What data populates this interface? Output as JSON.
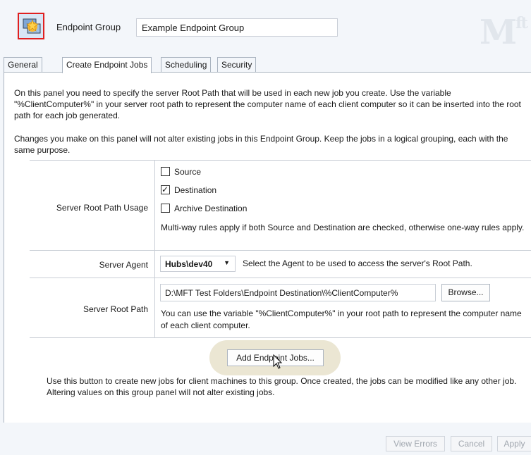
{
  "header": {
    "group_label": "Endpoint Group",
    "group_name": "Example Endpoint Group",
    "logo_text": "M",
    "logo_sup": "ft",
    "icon": "endpoint-group-icon"
  },
  "tabs": [
    {
      "label": "General",
      "active": false
    },
    {
      "label": "Create Endpoint Jobs",
      "active": true
    },
    {
      "label": "Scheduling",
      "active": false
    },
    {
      "label": "Security",
      "active": false
    }
  ],
  "panel": {
    "intro_1": "On this panel you need to specify the server Root Path that will be used in each new job you create. Use the variable \"%ClientComputer%\" in your server root path to represent the computer name of each client computer so it can be inserted into the root path for each job generated.",
    "intro_2": "Changes you make on this panel will not alter existing jobs in this Endpoint Group. Keep the jobs in a logical grouping, each with the same purpose.",
    "usage": {
      "label": "Server Root Path Usage",
      "options": [
        {
          "label": "Source",
          "checked": false
        },
        {
          "label": "Destination",
          "checked": true
        },
        {
          "label": "Archive Destination",
          "checked": false
        }
      ],
      "note": "Multi-way rules apply if both Source and Destination are checked, otherwise one-way rules apply."
    },
    "agent": {
      "label": "Server Agent",
      "selected": "Hubs\\dev40",
      "note": "Select the Agent to be used to access the server's Root Path."
    },
    "root_path": {
      "label": "Server Root Path",
      "value": "D:\\MFT Test Folders\\Endpoint Destination\\%ClientComputer%",
      "browse_label": "Browse...",
      "note": "You can use the variable \"%ClientComputer%\" in your root path to represent the computer name of each client computer."
    },
    "add_button_label": "Add Endpoint Jobs...",
    "add_note": "Use this button to create new jobs for client machines to this group. Once created, the jobs can be modified like any other job. Altering values on this group panel will not alter existing jobs."
  },
  "footer": {
    "view_errors": "View Errors",
    "cancel": "Cancel",
    "apply": "Apply"
  }
}
